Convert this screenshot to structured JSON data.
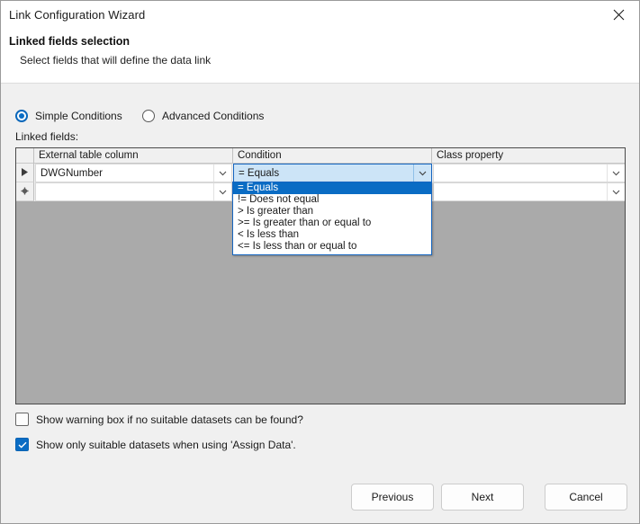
{
  "window": {
    "title": "Link Configuration Wizard",
    "close_icon": "close-icon"
  },
  "header": {
    "heading": "Linked fields selection",
    "subheading": "Select fields that will define the data link"
  },
  "mode_options": [
    {
      "label": "Simple Conditions",
      "checked": true
    },
    {
      "label": "Advanced Conditions",
      "checked": false
    }
  ],
  "grid": {
    "label": "Linked fields:",
    "columns": [
      "",
      "External table column",
      "Condition",
      "Class property"
    ],
    "rows": [
      {
        "indicator": "current-row-arrow",
        "external_table_column": "DWGNumber",
        "condition": "= Equals",
        "class_property": ""
      },
      {
        "indicator": "new-row-asterisk",
        "external_table_column": "",
        "condition": "",
        "class_property": ""
      }
    ]
  },
  "dropdown": {
    "open": true,
    "selected": "= Equals",
    "options": [
      "= Equals",
      "!= Does not equal",
      "> Is greater than",
      ">= Is greater than or equal to",
      "< Is less than",
      "<= Is less than or equal to"
    ]
  },
  "checkboxes": [
    {
      "label": "Show warning box if no suitable datasets can be found?",
      "checked": false
    },
    {
      "label": "Show only suitable datasets when using 'Assign Data'.",
      "checked": true
    }
  ],
  "buttons": {
    "previous": "Previous",
    "next": "Next",
    "cancel": "Cancel"
  },
  "colors": {
    "accent": "#0a6cc4",
    "selection": "#cce4f7",
    "grid_background": "#aaaaaa",
    "dialog_background": "#f0f0f0"
  }
}
